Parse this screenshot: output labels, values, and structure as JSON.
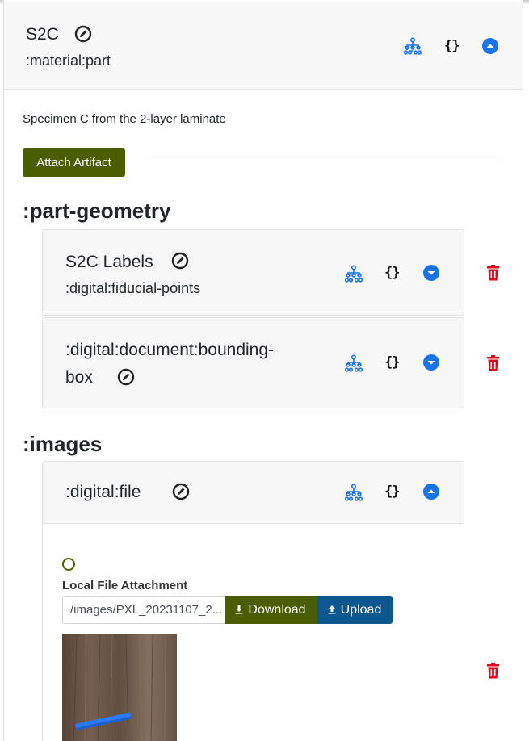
{
  "main": {
    "title": "S2C",
    "type": ":material:part",
    "description": "Specimen C from the 2-layer laminate",
    "attach_label": "Attach Artifact",
    "braces": "{}"
  },
  "sections": [
    {
      "title": ":part-geometry",
      "items": [
        {
          "title": "S2C Labels",
          "type": ":digital:fiducial-points",
          "braces": "{}"
        },
        {
          "title_line1": ":digital:document:bounding-",
          "title_line2": "box",
          "braces": "{}"
        }
      ]
    },
    {
      "title": ":images",
      "items": [
        {
          "title": ":digital:file",
          "braces": "{}",
          "file_label": "Local File Attachment",
          "path_value": "/images/PXL_20231107_2...",
          "download_label": "Download",
          "upload_label": "Upload"
        }
      ]
    }
  ],
  "colors": {
    "accent_blue": "#1a73e8",
    "olive_button": "#4a5e00",
    "upload_blue": "#0b5790",
    "trash_red": "#e0001b"
  },
  "icons": [
    "edit-icon",
    "hierarchy-icon",
    "json-braces-icon",
    "chevron-up-icon",
    "chevron-down-icon",
    "trash-icon",
    "download-icon",
    "upload-icon"
  ]
}
